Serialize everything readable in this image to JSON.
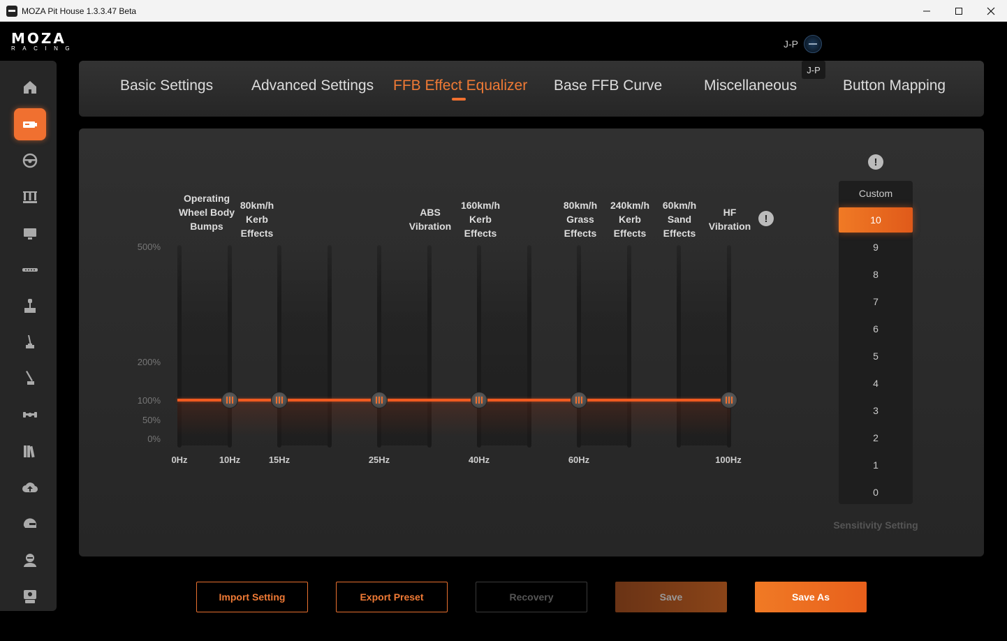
{
  "window": {
    "title": "MOZA Pit House 1.3.3.47 Beta"
  },
  "logo": {
    "main": "MOZA",
    "sub": "RACING"
  },
  "user": {
    "name": "J-P",
    "tooltip": "J-P"
  },
  "tabs": [
    {
      "label": "Basic Settings",
      "active": false
    },
    {
      "label": "Advanced Settings",
      "active": false
    },
    {
      "label": "FFB Effect Equalizer",
      "active": true
    },
    {
      "label": "Base FFB Curve",
      "active": false
    },
    {
      "label": "Miscellaneous",
      "active": false
    },
    {
      "label": "Button Mapping",
      "active": false
    }
  ],
  "sidebar": [
    {
      "icon": "home-icon"
    },
    {
      "icon": "wheelbase-icon",
      "active": true
    },
    {
      "icon": "steering-wheel-icon"
    },
    {
      "icon": "pedals-icon"
    },
    {
      "icon": "dashboard-icon"
    },
    {
      "icon": "rpm-bar-icon"
    },
    {
      "icon": "shifter-icon"
    },
    {
      "icon": "handbrake-icon"
    },
    {
      "icon": "sequential-shifter-icon"
    },
    {
      "icon": "flight-yoke-icon"
    },
    {
      "icon": "library-icon"
    },
    {
      "icon": "cloud-upload-icon"
    },
    {
      "icon": "helmet-icon"
    },
    {
      "icon": "user-icon"
    },
    {
      "icon": "support-icon"
    }
  ],
  "equalizer": {
    "y_labels": [
      "500%",
      "200%",
      "100%",
      "50%",
      "0%"
    ],
    "x_labels": [
      "0Hz",
      "10Hz",
      "15Hz",
      "25Hz",
      "40Hz",
      "60Hz",
      "100Hz"
    ],
    "effect_labels": [
      "Operating Wheel Body Bumps",
      "80km/h Kerb Effects",
      "ABS Vibration",
      "160km/h Kerb Effects",
      "80km/h Grass Effects",
      "240km/h Kerb Effects",
      "60km/h Sand Effects",
      "HF Vibration"
    ],
    "info_icon": "!",
    "bands": [
      {
        "freq": "10Hz",
        "value_percent": 100
      },
      {
        "freq": "15Hz",
        "value_percent": 100
      },
      {
        "freq": "25Hz",
        "value_percent": 100
      },
      {
        "freq": "40Hz",
        "value_percent": 100
      },
      {
        "freq": "60Hz",
        "value_percent": 100
      },
      {
        "freq": "100Hz",
        "value_percent": 100
      }
    ]
  },
  "sensitivity": {
    "info_icon": "!",
    "title": "Custom",
    "options": [
      "10",
      "9",
      "8",
      "7",
      "6",
      "5",
      "4",
      "3",
      "2",
      "1",
      "0"
    ],
    "selected": "10",
    "caption": "Sensitivity Setting"
  },
  "buttons": {
    "import": "Import Setting",
    "export": "Export Preset",
    "recovery": "Recovery",
    "save": "Save",
    "save_as": "Save As"
  },
  "colors": {
    "accent": "#f07030",
    "background": "#000000",
    "panel": "#2a2a2a"
  }
}
